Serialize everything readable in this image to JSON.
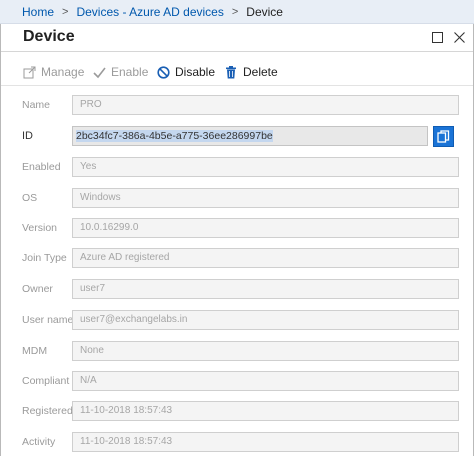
{
  "breadcrumb": {
    "items": [
      "Home",
      "Devices - Azure AD devices",
      "Device"
    ],
    "separator": ">"
  },
  "blade": {
    "title": "Device"
  },
  "toolbar": {
    "manage_label": "Manage",
    "enable_label": "Enable",
    "disable_label": "Disable",
    "delete_label": "Delete"
  },
  "fields": [
    {
      "label": "Name",
      "value": "PRO"
    },
    {
      "label": "ID",
      "value": "2bc34fc7-386a-4b5e-a775-36ee286997be"
    },
    {
      "label": "Enabled",
      "value": "Yes"
    },
    {
      "label": "OS",
      "value": "Windows"
    },
    {
      "label": "Version",
      "value": "10.0.16299.0"
    },
    {
      "label": "Join Type",
      "value": "Azure AD registered"
    },
    {
      "label": "Owner",
      "value": "user7"
    },
    {
      "label": "User name",
      "value": "user7@exchangelabs.in"
    },
    {
      "label": "MDM",
      "value": "None"
    },
    {
      "label": "Compliant",
      "value": "N/A"
    },
    {
      "label": "Registered",
      "value": "11-10-2018 18:57:43"
    },
    {
      "label": "Activity",
      "value": "11-10-2018 18:57:43"
    }
  ],
  "colors": {
    "link": "#0058ad",
    "accent": "#1a73d6",
    "breadcrumb_bg": "#e8eef6"
  },
  "icons": {
    "manage": "external-link-icon",
    "enable": "checkmark-icon",
    "disable": "block-icon",
    "delete": "trash-icon",
    "copy": "copy-icon",
    "maximize": "maximize-icon",
    "close": "close-icon"
  }
}
